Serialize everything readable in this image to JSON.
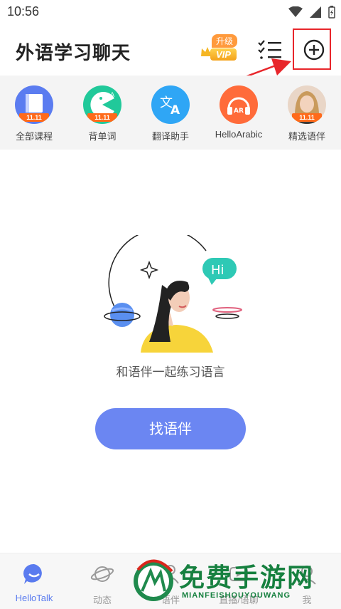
{
  "status": {
    "time": "10:56"
  },
  "header": {
    "title": "外语学习聊天",
    "vip_up": "升级",
    "vip_label": "VIP"
  },
  "shortcuts": [
    {
      "label": "全部课程",
      "icon": "book-icon",
      "color": "#5b7cf0",
      "tag": "11.11"
    },
    {
      "label": "背单词",
      "icon": "pacman-words-icon",
      "color": "#21c99a",
      "tag": "11.11"
    },
    {
      "label": "翻译助手",
      "icon": "translate-icon",
      "color": "#2fa6f5"
    },
    {
      "label": "HelloArabic",
      "icon": "headphones-ar-icon",
      "color": "#ff6b3a"
    },
    {
      "label": "精选语伴",
      "icon": "partner-avatar-icon",
      "color": "#c97a5a",
      "tag": "11.11"
    }
  ],
  "empty_state": {
    "bubble": "Hi",
    "text": "和语伴一起练习语言",
    "button": "找语伴"
  },
  "nav": [
    {
      "label": "HelloTalk",
      "icon": "chat-icon"
    },
    {
      "label": "动态",
      "icon": "planet-icon"
    },
    {
      "label": "语伴",
      "icon": "partner-icon"
    },
    {
      "label": "直播/语聊",
      "icon": "live-icon"
    },
    {
      "label": "我",
      "icon": "profile-icon"
    }
  ],
  "watermark": {
    "title": "免费手游网",
    "subtitle": "MIANFEISHOUYOUWANG"
  },
  "colors": {
    "accent": "#6b86f2",
    "highlight": "#e8262b",
    "vip": "#f4a21a"
  }
}
